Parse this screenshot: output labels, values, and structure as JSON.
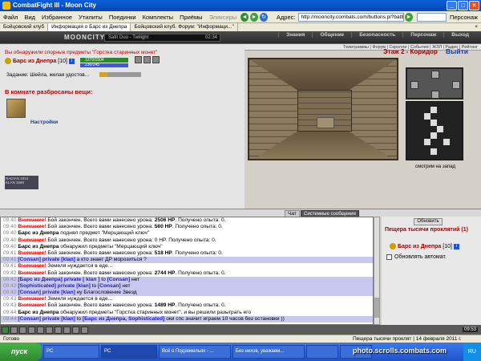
{
  "window": {
    "title": "CombatFight III - Moon City"
  },
  "menu": {
    "items": [
      "Файл",
      "Вид",
      "Избранное",
      "Утилиты",
      "Поединки",
      "Комплекты",
      "Приёмы",
      "Эликсиры"
    ],
    "address_label": "Адрес:",
    "address_value": "http://mooncity.combats.com/buttons.pl?battle",
    "person_label": "Персонаж"
  },
  "tabs": [
    {
      "label": "Бойцовский клуб"
    },
    {
      "label": "Информация о Барс из Днепра"
    },
    {
      "label": "Бойцовский клуб. Форум: \"Информаци...\""
    }
  ],
  "header": {
    "logo": "MOONCITY",
    "radio": "Safri Duo - Twilight",
    "time": "02:34",
    "nav": [
      "Знания",
      "Общение",
      "Безопасность",
      "Персонаж",
      "Выход"
    ],
    "subnav": "Телеграммы | Форум | Скролли | События | ЖЗЛ | Радио | Рейтинг"
  },
  "game": {
    "found_message": "Вы обнаружили спорные предметы \"Горстка старинных монет\"",
    "player_name": "Барс из Днепра",
    "player_level": "[10]",
    "hp": "1270/1504",
    "mp": "230/245",
    "quest": "Задание: Шейла, желая удостов...",
    "quest_progress": "0/5",
    "items_title": "В комнате разбросаны вещи:",
    "settings": "Настройки",
    "location": "Этаж 2 - Коридор",
    "exit": "Выйти",
    "look": "смотрим на запад",
    "counter": "RADIAN 2024 KLAN 1660"
  },
  "chat": {
    "tab_chat": "Чат",
    "tab_sys": "Системные сообщения",
    "lines": [
      {
        "t": "09:40",
        "parts": [
          [
            "red",
            "Внимание!"
          ],
          [
            "",
            " Бой закончен. Всего вами нанесено урона: "
          ],
          [
            "b",
            "2506 HP"
          ],
          [
            "",
            ". Получено опыта: 0."
          ]
        ]
      },
      {
        "t": "09:40",
        "parts": [
          [
            "red",
            "Внимание!"
          ],
          [
            "",
            " Бой закончен. Всего вами нанесено урона: "
          ],
          [
            "b",
            "560 HP"
          ],
          [
            "",
            ". Получено опыта: 0."
          ]
        ]
      },
      {
        "t": "09:40",
        "parts": [
          [
            "b",
            "Барс из Днепра"
          ],
          [
            "",
            " поднял предмет \"Мерцающий ключ\""
          ]
        ]
      },
      {
        "t": "09:40",
        "parts": [
          [
            "red",
            "Внимание!"
          ],
          [
            "",
            " Бой закончен. Всего вами нанесено урона: 0 HP. Получено опыта: 0."
          ]
        ]
      },
      {
        "t": "09:40",
        "parts": [
          [
            "b",
            "Барс из Днепра"
          ],
          [
            "",
            " обнаружил предметы \"Мерцающий ключ\""
          ]
        ]
      },
      {
        "t": "09:41",
        "parts": [
          [
            "red",
            "Внимание!"
          ],
          [
            "",
            " Бой закончен. Всего вами нанесено урона: "
          ],
          [
            "b",
            "518 HP"
          ],
          [
            "",
            ". Получено опыта: 0."
          ]
        ]
      },
      {
        "t": "09:41",
        "hl": true,
        "parts": [
          [
            "blue",
            "[Consan] private [klan]"
          ],
          [
            "",
            " а кто знает ДР морозиться ?"
          ]
        ]
      },
      {
        "t": "09:41",
        "parts": [
          [
            "red",
            "Внимание!"
          ],
          [
            "",
            " Земеля нуждается в еде..."
          ]
        ]
      },
      {
        "t": "09:42",
        "parts": [
          [
            "red",
            "Внимание!"
          ],
          [
            "",
            " Бой закончен. Всего вами нанесено урона: "
          ],
          [
            "b",
            "2744 HP"
          ],
          [
            "",
            ". Получено опыта: 0."
          ]
        ]
      },
      {
        "t": "09:42",
        "hl": true,
        "parts": [
          [
            "blue",
            "[Барс из Днепра] private [ klan ]"
          ],
          [
            "",
            " to "
          ],
          [
            "blue",
            "[Consan]"
          ],
          [
            "",
            " нет"
          ]
        ]
      },
      {
        "t": "09:42",
        "hl": true,
        "parts": [
          [
            "blue",
            "[Sophisticated] private [klan]"
          ],
          [
            "",
            " to "
          ],
          [
            "blue",
            "[Consan]"
          ],
          [
            "",
            " нет"
          ]
        ]
      },
      {
        "t": "09:42",
        "hl": true,
        "parts": [
          [
            "blue",
            "[Consan] private [klan]"
          ],
          [
            "",
            " ну Благословение Звезд"
          ]
        ]
      },
      {
        "t": "09:43",
        "parts": [
          [
            "red",
            "Внимание!"
          ],
          [
            "",
            " Земеля нуждается в еде..."
          ]
        ]
      },
      {
        "t": "09:43",
        "parts": [
          [
            "red",
            "Внимание!"
          ],
          [
            "",
            " Бой закончен. Всего вами нанесено урона: "
          ],
          [
            "b",
            "1489 HP"
          ],
          [
            "",
            ". Получено опыта: 0."
          ]
        ]
      },
      {
        "t": "09:44",
        "parts": [
          [
            "b",
            "Барс из Днепра"
          ],
          [
            "",
            " обнаружил предметы \"Горстка старинных монет\", и вы решили разыграть его"
          ]
        ]
      },
      {
        "t": "09:44",
        "hl": true,
        "parts": [
          [
            "blue",
            "[Consan] private [klan]"
          ],
          [
            "",
            " to "
          ],
          [
            "blue",
            "[Барс из Днепра, Sophisticated]"
          ],
          [
            "",
            " оки спс значит играем 10 часов без остановки ))"
          ]
        ]
      }
    ]
  },
  "side": {
    "refresh": "Обновить",
    "cave": "Пещера тысячи проклятий (1)",
    "member_name": "Барс из Днепра",
    "member_level": "[10]",
    "auto_update": "Обновлять автомат."
  },
  "toolbar": {
    "clock": "09:53"
  },
  "status": {
    "left": "Готово",
    "right": "Пещера тысячи проклят | 14 февраля 2011 г."
  },
  "taskbar": {
    "start": "пуск",
    "tasks": [
      "PC",
      "PC",
      "Всё о Подземельях - ...",
      "Без нихов, уважаем...",
      "",
      ""
    ],
    "tray": "RU"
  },
  "watermark": "photo.scrolls.combats.com"
}
